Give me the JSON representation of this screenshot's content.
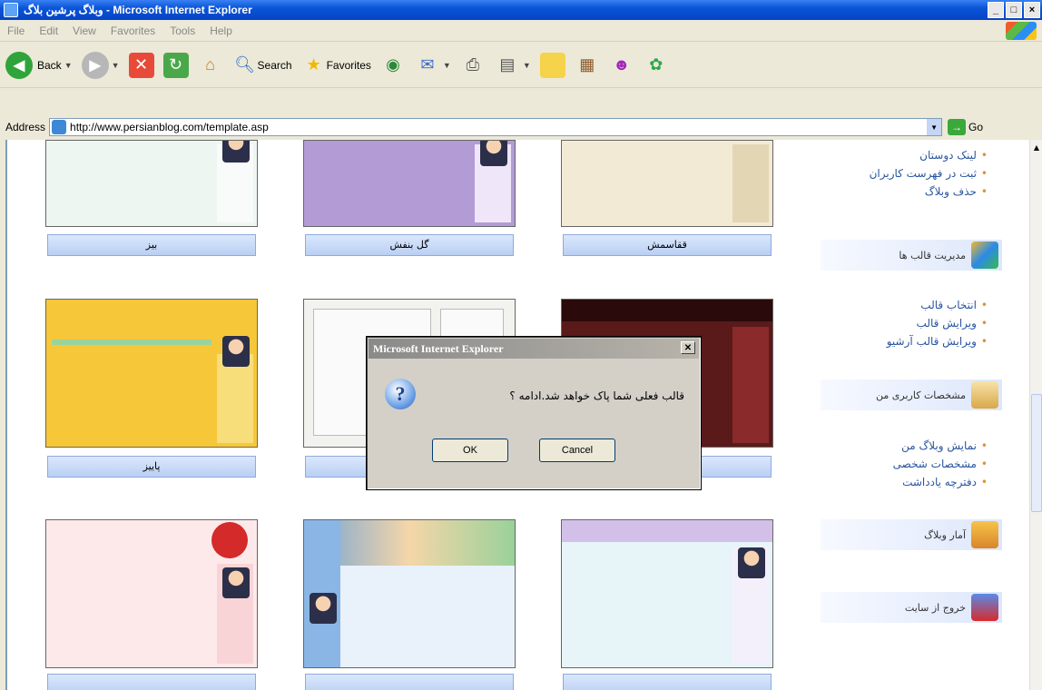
{
  "window": {
    "title": "وبلاگ پرشین بلاگ - Microsoft Internet Explorer",
    "controls": [
      "_",
      "□",
      "×"
    ]
  },
  "menu": [
    "File",
    "Edit",
    "View",
    "Favorites",
    "Tools",
    "Help"
  ],
  "toolbar": {
    "back": "Back",
    "search": "Search",
    "favorites": "Favorites"
  },
  "address": {
    "label": "Address",
    "url": "http://www.persianblog.com/template.asp",
    "go": "Go"
  },
  "templates": [
    {
      "label": "بیز",
      "thumb_color": "#eef6f2"
    },
    {
      "label": "گل بنفش",
      "thumb_color": "#b39bd6"
    },
    {
      "label": "ققاسمش",
      "thumb_color": "#f3ead6"
    },
    {
      "label": "پاییز",
      "thumb_color": "#f7c73a"
    },
    {
      "label": "",
      "thumb_color": "#f2f2ef"
    },
    {
      "label": "",
      "thumb_color": "#5a1a1a"
    },
    {
      "label": "",
      "thumb_color": "#fde9ea"
    },
    {
      "label": "",
      "thumb_color": "#e9f1fb"
    },
    {
      "label": "",
      "thumb_color": "#e7f4f8"
    }
  ],
  "nav": {
    "links_top": [
      "لینک دوستان",
      "ثبت در فهرست کاربران",
      "حذف وبلاگ"
    ],
    "section_templates": "مدیریت قالب ها",
    "links_templates": [
      "انتخاب قالب",
      "ویرایش قالب",
      "ویرایش قالب آرشیو"
    ],
    "section_profile": "مشخصات کاربری من",
    "links_profile": [
      "نمایش وبلاگ من",
      "مشخصات شخصی",
      "دفترچه یادداشت"
    ],
    "section_stats": "آمار وبلاگ",
    "section_exit": "خروج از سایت"
  },
  "dialog": {
    "title": "Microsoft Internet Explorer",
    "message": "قالب فعلی شما پاک خواهد شد.ادامه ؟",
    "ok": "OK",
    "cancel": "Cancel"
  }
}
